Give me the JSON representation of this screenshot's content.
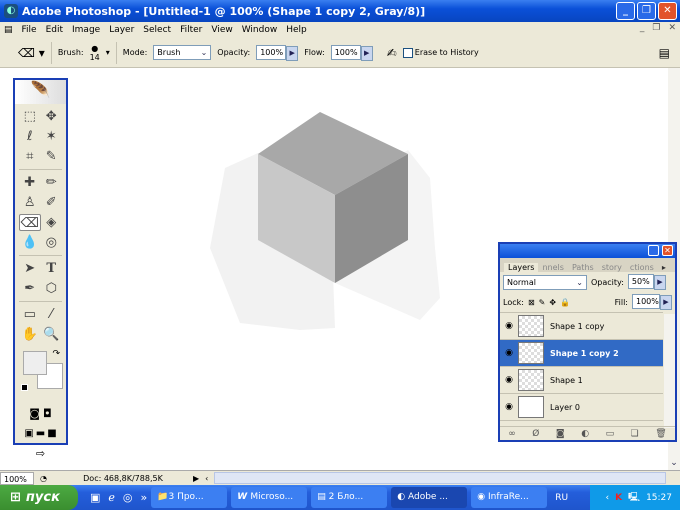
{
  "window": {
    "title": "Adobe Photoshop - [Untitled-1 @ 100% (Shape 1 copy 2, Gray/8)]"
  },
  "menu": [
    "File",
    "Edit",
    "Image",
    "Layer",
    "Select",
    "Filter",
    "View",
    "Window",
    "Help"
  ],
  "options": {
    "brush_label": "Brush:",
    "brush_size": "14",
    "mode_label": "Mode:",
    "mode_value": "Brush",
    "opacity_label": "Opacity:",
    "opacity_value": "100%",
    "flow_label": "Flow:",
    "flow_value": "100%",
    "erase_history": "Erase to History"
  },
  "layers_panel": {
    "tabs": [
      "Layers",
      "nnels",
      "Paths",
      "story",
      "ctions"
    ],
    "blend_mode": "Normal",
    "opacity_label": "Opacity:",
    "opacity_value": "50%",
    "lock_label": "Lock:",
    "fill_label": "Fill:",
    "fill_value": "100%",
    "layers": [
      {
        "name": "Shape 1 copy",
        "selected": false
      },
      {
        "name": "Shape 1 copy 2",
        "selected": true
      },
      {
        "name": "Shape 1",
        "selected": false
      },
      {
        "name": "Layer 0",
        "selected": false
      }
    ]
  },
  "status": {
    "zoom": "100%",
    "doc": "Doc: 468,8K/788,5K"
  },
  "taskbar": {
    "start": "пуск",
    "tasks": [
      "3 Про...",
      "Microso...",
      "2 Бло...",
      "Adobe ...",
      "InfraRe..."
    ],
    "lang": "RU",
    "clock": "15:27"
  },
  "colors": {
    "titlebar": "#0a50d8",
    "selection": "#316ac5",
    "cube_top": "#a8a8a8",
    "cube_left": "#c8c8c8",
    "cube_right": "#8e8e8e"
  }
}
